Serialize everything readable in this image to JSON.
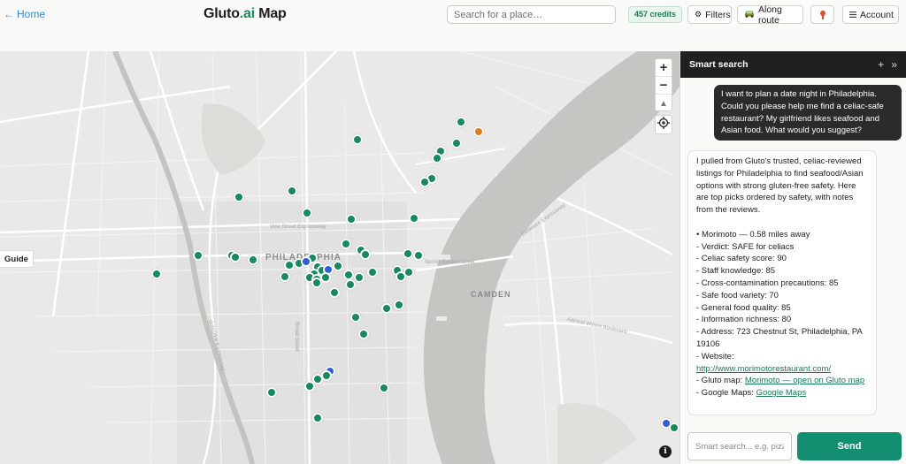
{
  "header": {
    "home_label": "Home",
    "title_prefix": "Gluto",
    "title_ai": ".ai",
    "title_suffix": " Map",
    "search_placeholder": "Search for a place…",
    "credits": "457 credits",
    "filters_label": "Filters",
    "route_label": "Along route",
    "account_label": "Account"
  },
  "map": {
    "city_label": "PHILADELPHIA",
    "camden_label": "CAMDEN",
    "guide_label": "Guide",
    "info_label": "i",
    "zoom_in": "+",
    "zoom_out": "−",
    "reset_north": "▲",
    "marker_colors": {
      "green": "#168a5e",
      "blue": "#2f5fd8",
      "orange": "#d9801d"
    },
    "street_labels": [
      "Vine Street Expressway",
      "Spring Garden Street",
      "Schuylkill Expressway",
      "Broad Street",
      "Delaware Expressway",
      "Admiral Wilson Boulevard"
    ]
  },
  "panel": {
    "title": "Smart search",
    "add_icon": "+",
    "collapse_icon": "»",
    "user_message": "I want to plan a date night in Philadelphia. Could you please help me find a celiac-safe restaurant? My girlfriend likes seafood and Asian food. What would you suggest?",
    "bot_intro": "I pulled from Gluto's trusted, celiac-reviewed listings for Philadelphia to find seafood/Asian options with strong gluten-free safety. Here are top picks ordered by safety, with notes from the reviews.",
    "bot_lines": [
      "• Morimoto — 0.58 miles away",
      "- Verdict: SAFE for celiacs",
      "- Celiac safety score: 90",
      "- Staff knowledge: 85",
      "- Cross-contamination precautions: 85",
      "- Safe food variety: 70",
      "- General food quality: 85",
      "- Information richness: 80",
      "- Address: 723 Chestnut St, Philadelphia, PA 19106",
      "- Website:"
    ],
    "website_url": "http://www.morimotorestaurant.com/",
    "gluto_map_prefix": "- Gluto map: ",
    "gluto_map_link": "Morimoto — open on Gluto map",
    "google_prefix": "- Google Maps: ",
    "google_link": "Google Maps",
    "input_placeholder": "Smart search... e.g. pizza",
    "send_label": "Send"
  }
}
